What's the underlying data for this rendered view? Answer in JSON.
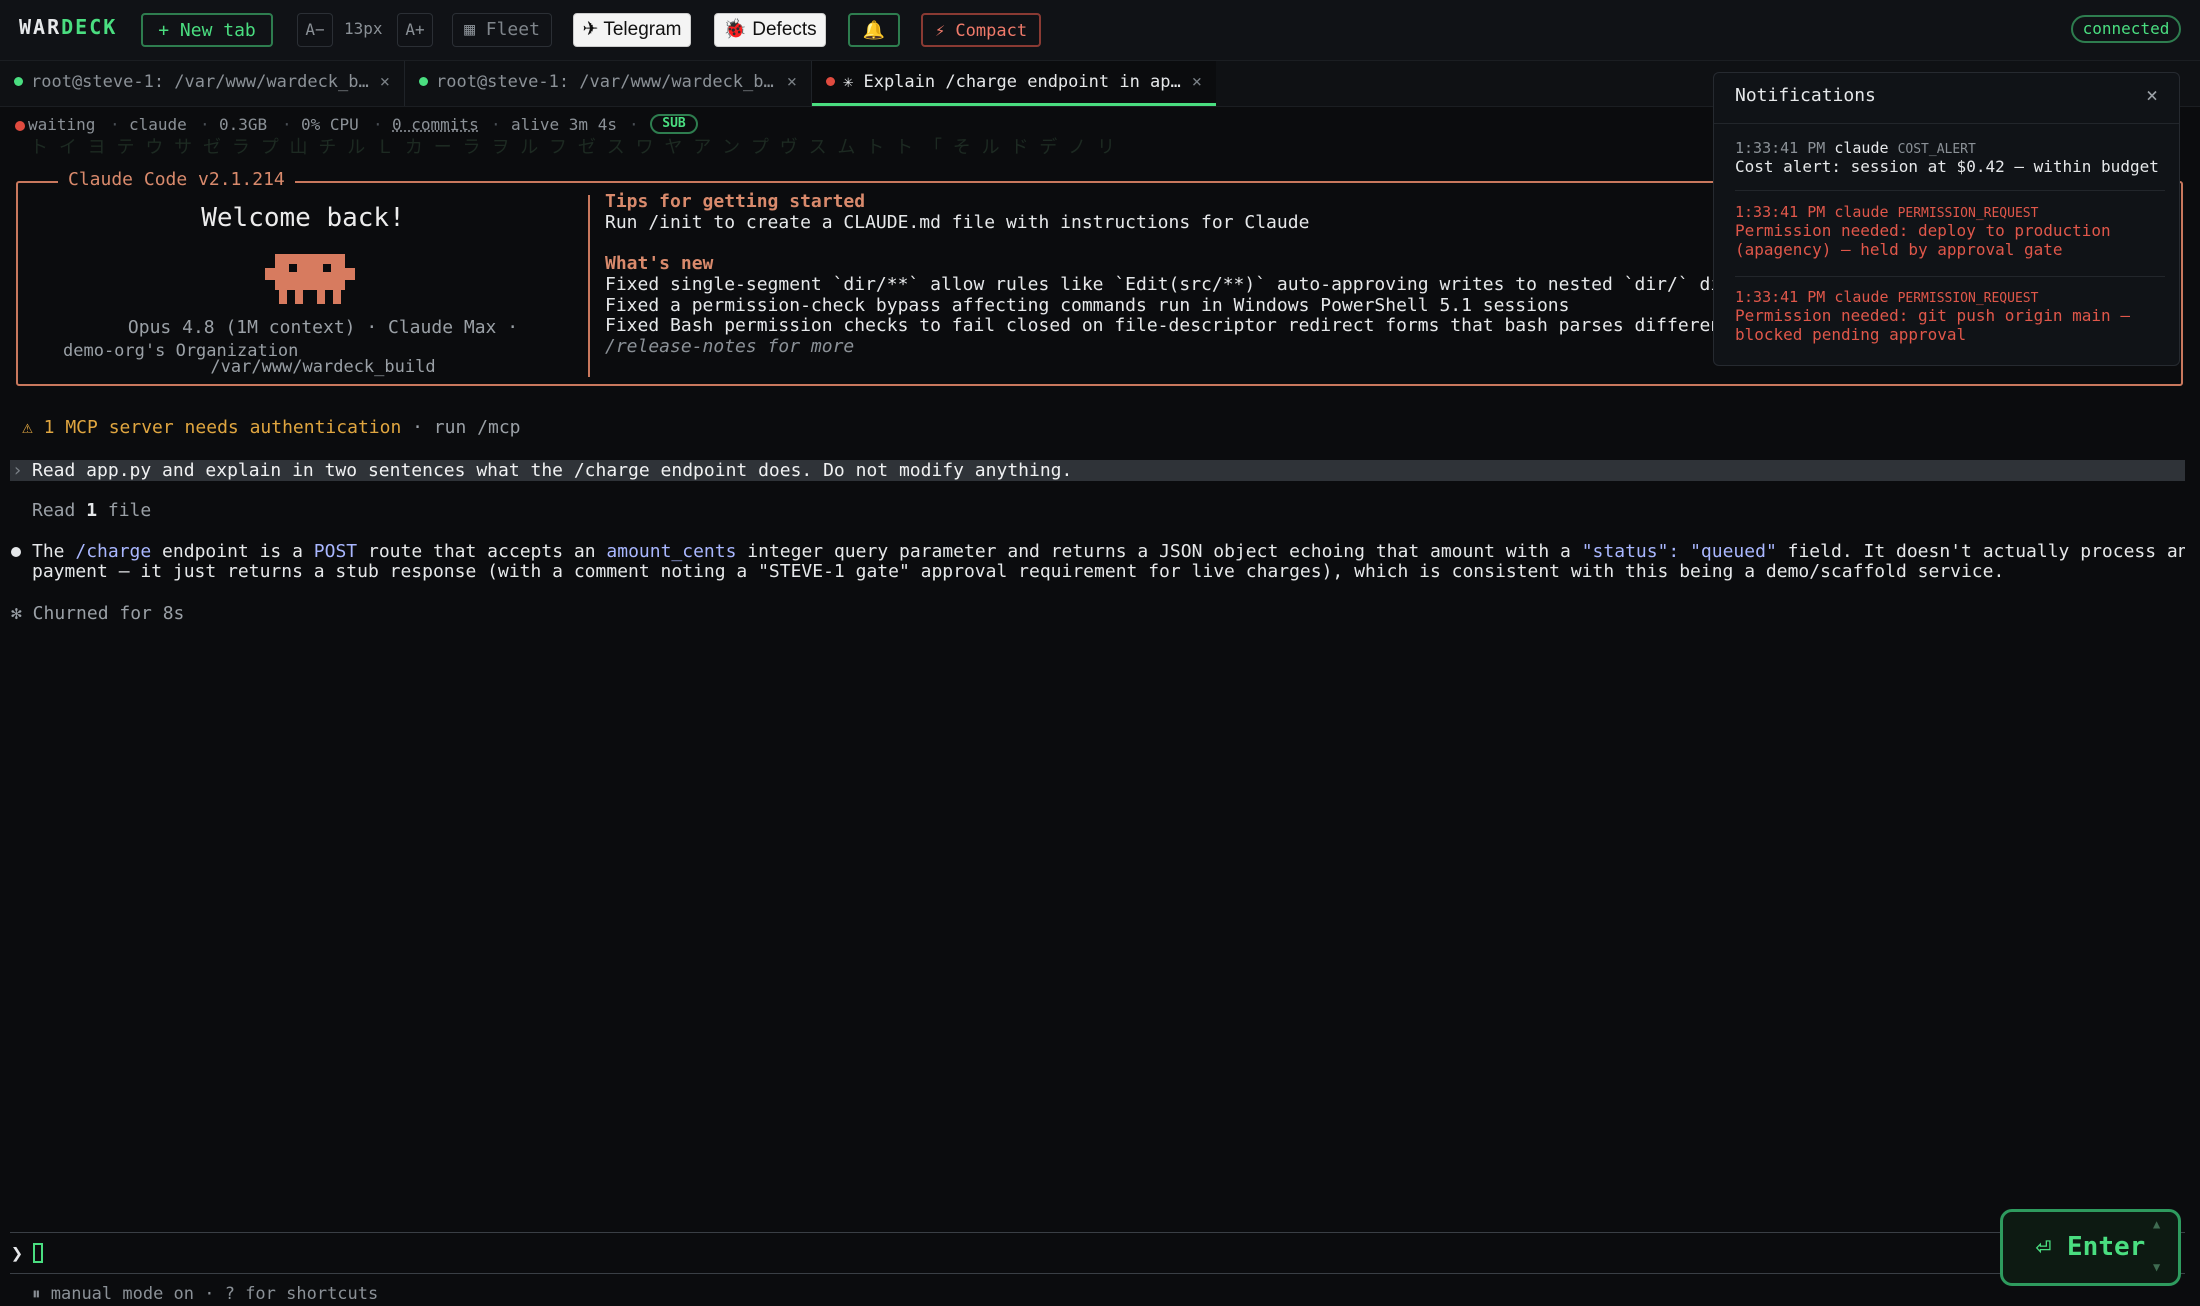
{
  "app": {
    "logo_a": "WAR",
    "logo_b": "DECK",
    "connection_status": "connected"
  },
  "toolbar": {
    "new_tab": "+ New tab",
    "font_decrease": "A−",
    "font_size": "13px",
    "font_increase": "A+",
    "fleet": "▦ Fleet",
    "telegram": "✈ Telegram",
    "defects": "🐞 Defects",
    "bell": "🔔",
    "compact": "⚡ Compact"
  },
  "tabs": [
    {
      "label": "root@steve-1: /var/www/wardeck_b…",
      "status_color": "#4ade80",
      "close": "×"
    },
    {
      "label": "root@steve-1: /var/www/wardeck_b…",
      "status_color": "#4ade80",
      "close": "×"
    },
    {
      "label": "✳ Explain /charge endpoint in ap…",
      "status_color": "#e04b3f",
      "close": "×"
    }
  ],
  "session_status": {
    "state": "waiting",
    "agent": "claude",
    "memory": "0.3GB",
    "cpu": "0% CPU",
    "commits": "0 commits",
    "alive": "alive 3m 4s",
    "badge": "SUB",
    "separator": "·"
  },
  "background_glyphs": "ト イ ヨ テ ウ サ ゼ ラ プ 山 チ ル Ｌ カ ー ラ ヲ ル フ ゼ ス ワ ヤ ア ン プ ヴ ス ム ト ト 「 そ ル ド デ ノ リ",
  "welcome": {
    "title": "Claude Code v2.1.214",
    "greeting": "Welcome back!",
    "model": "Opus 4.8 (1M context) · Claude Max ·",
    "org": "demo-org's Organization",
    "path": "/var/www/wardeck_build",
    "tips_heading": "Tips for getting started",
    "tips_text": "Run /init to create a CLAUDE.md file with instructions for Claude",
    "whats_new_heading": "What's new",
    "whats_new": [
      "Fixed single-segment `dir/**` allow rules like `Edit(src/**)` auto-approving writes to nested `dir/` directories anywhere in the tree instead of…",
      "Fixed a permission-check bypass affecting commands run in Windows PowerShell 5.1 sessions",
      "Fixed Bash permission checks to fail closed on file-descriptor redirect forms that bash parses differently"
    ],
    "release_notes": "/release-notes for more"
  },
  "conversation": {
    "mcp_warning": "⚠ 1 MCP server needs authentication",
    "mcp_hint": " · run /mcp",
    "prompt_marker": "›",
    "user_prompt": "Read app.py and explain in two sentences what the /charge endpoint does. Do not modify anything.",
    "read_prefix": "Read ",
    "read_count": "1",
    "read_suffix": " file",
    "answer_line1_parts": [
      "The ",
      "/charge",
      " endpoint is a ",
      "POST",
      " route that accepts an ",
      "amount_cents",
      " integer query parameter and returns a JSON object echoing that amount with a ",
      "\"status\": \"queued\"",
      " field. It doesn't actually process any"
    ],
    "answer_line2": "payment — it just returns a stub response (with a comment noting a \"STEVE-1 gate\" approval requirement for live charges), which is consistent with this being a demo/scaffold service.",
    "churn": "✻ Churned for 8s"
  },
  "input": {
    "chevron": "❯",
    "mode_line": "⏸ manual mode on · ? for shortcuts",
    "enter_label": "⏎ Enter",
    "scroll_up": "▲",
    "scroll_down": "▼"
  },
  "notifications": {
    "title": "Notifications",
    "close": "×",
    "items": [
      {
        "time": "1:33:41 PM",
        "source": "claude",
        "type": "COST_ALERT",
        "message": "Cost alert: session at $0.42 — within budget"
      },
      {
        "time": "1:33:41 PM",
        "source": "claude",
        "type": "PERMISSION_REQUEST",
        "message": "Permission needed: deploy to production (apagency) — held by approval gate"
      },
      {
        "time": "1:33:41 PM",
        "source": "claude",
        "type": "PERMISSION_REQUEST",
        "message": "Permission needed: git push origin main — blocked pending approval"
      }
    ]
  }
}
